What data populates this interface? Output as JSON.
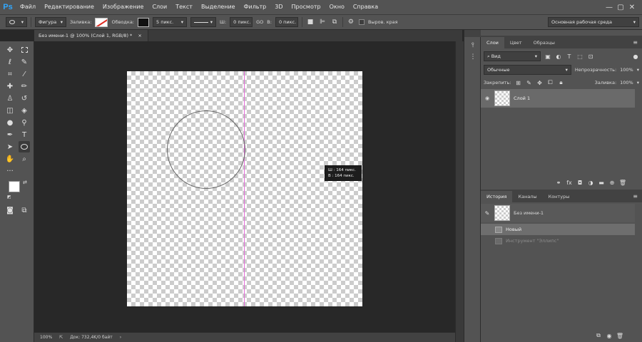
{
  "app": {
    "logo": "Ps"
  },
  "menu": [
    "Файл",
    "Редактирование",
    "Изображение",
    "Слои",
    "Текст",
    "Выделение",
    "Фильтр",
    "3D",
    "Просмотр",
    "Окно",
    "Справка"
  ],
  "window_controls": {
    "minimize": "—",
    "maximize": "▢",
    "close": "✕"
  },
  "options": {
    "mode": "Фигура",
    "fill_label": "Заливка:",
    "stroke_label": "Обводка:",
    "stroke_width": "5 пикс.",
    "w_label": "Ш:",
    "w_value": "0 пикс.",
    "link": "GO",
    "h_label": "В:",
    "h_value": "0 пикс.",
    "align_edges": "Выров. края",
    "workspace": "Основная рабочая среда"
  },
  "document": {
    "tab_title": "Без имени-1 @ 100% (Слой 1, RGB/8) *",
    "tab_close": "×"
  },
  "size_tooltip": {
    "w": "Ш :   164 пикс.",
    "h": "В :   164 пикс."
  },
  "status": {
    "zoom": "100%",
    "doc_info": "Док: 732,4K/0 байт",
    "arrow": "›"
  },
  "layers_panel": {
    "tabs": [
      "Слои",
      "Цвет",
      "Образцы"
    ],
    "kind": "Вид",
    "blend_mode": "Обычные",
    "opacity_label": "Непрозрачность:",
    "opacity_value": "100%",
    "lock_label": "Закрепить:",
    "fill_label": "Заливка:",
    "fill_value": "100%",
    "layer_name": "Слой 1"
  },
  "history_panel": {
    "tabs": [
      "История",
      "Каналы",
      "Контуры"
    ],
    "snapshot": "Без имени-1",
    "items": [
      "Новый",
      "Инструмент \"Эллипс\""
    ]
  },
  "icons": {
    "menu": "≡",
    "eye": "👁",
    "search": "⌕",
    "gear": "⚙",
    "dropdown": "▾",
    "trash": "🗑"
  }
}
